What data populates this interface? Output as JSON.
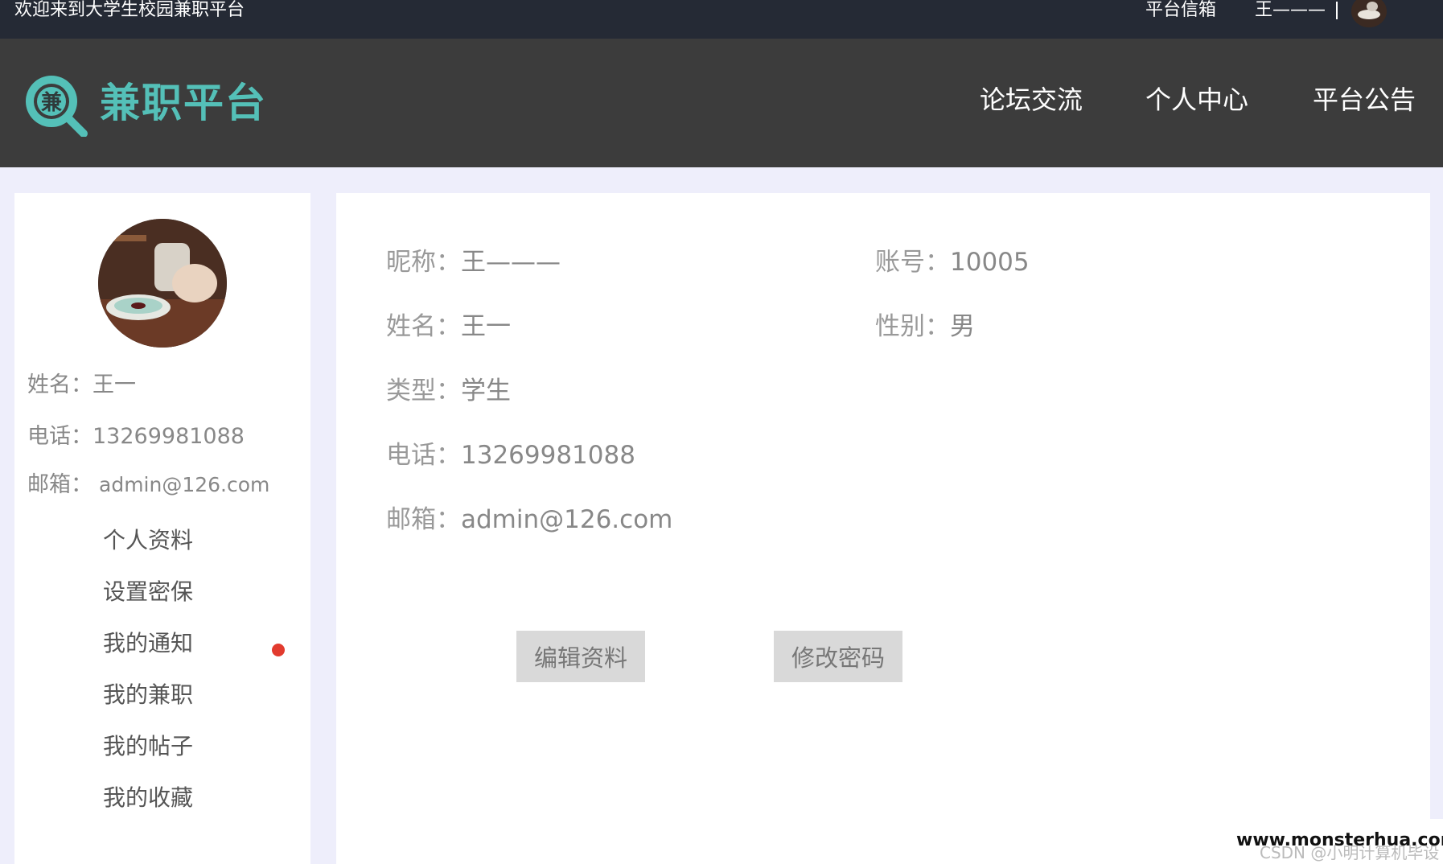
{
  "topbar": {
    "welcome": "欢迎来到大学生校园兼职平台",
    "mailbox": "平台信箱",
    "username": "王———"
  },
  "header": {
    "logo_char": "兼",
    "logo_text": "兼职平台",
    "nav": [
      "论坛交流",
      "个人中心",
      "平台公告"
    ]
  },
  "sidebar": {
    "name_label": "姓名：",
    "name_value": "王一",
    "phone_label": "电话：",
    "phone_value": "13269981088",
    "email_label": "邮箱：",
    "email_value": "admin@126.com",
    "menu": [
      "个人资料",
      "设置密保",
      "我的通知",
      "我的兼职",
      "我的帖子",
      "我的收藏"
    ]
  },
  "profile": {
    "nickname_label": "昵称：",
    "nickname_value": "王———",
    "account_label": "账号：",
    "account_value": "10005",
    "name_label": "姓名：",
    "name_value": "王一",
    "gender_label": "性别：",
    "gender_value": "男",
    "type_label": "类型：",
    "type_value": "学生",
    "phone_label": "电话：",
    "phone_value": "13269981088",
    "email_label": "邮箱：",
    "email_value": "admin@126.com"
  },
  "buttons": {
    "edit": "编辑资料",
    "change_password": "修改密码"
  },
  "watermark": {
    "site": "www.monsterhua.com",
    "credit": "CSDN @小明计算机毕设"
  },
  "colors": {
    "topbar": "#252a35",
    "header": "#3c3c3c",
    "brand": "#54c0b8",
    "notification_dot": "#e23b2e",
    "page_bg": "#eeeefb"
  },
  "icons": {
    "logo": "search-magnifier-icon",
    "notification": "red-dot-badge"
  }
}
